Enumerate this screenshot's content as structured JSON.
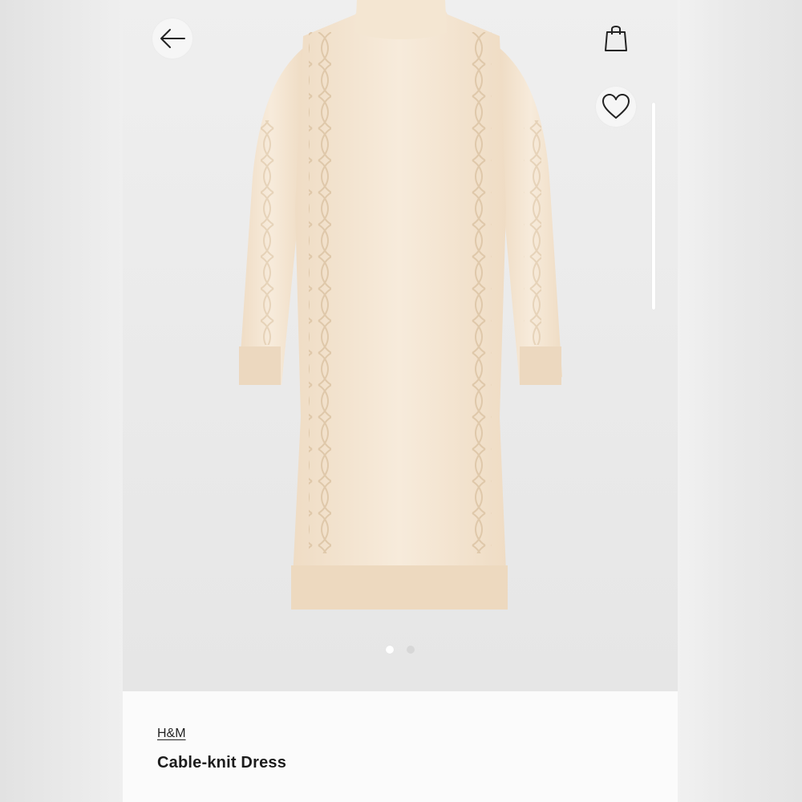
{
  "header": {
    "back_icon": "arrow-left-icon",
    "bag_icon": "shopping-bag-icon",
    "favorite_icon": "heart-icon"
  },
  "gallery": {
    "image_count": 2,
    "active_index": 0,
    "garment_color": "#f3e6d3"
  },
  "product": {
    "brand": "H&M",
    "name": "Cable-knit Dress"
  }
}
